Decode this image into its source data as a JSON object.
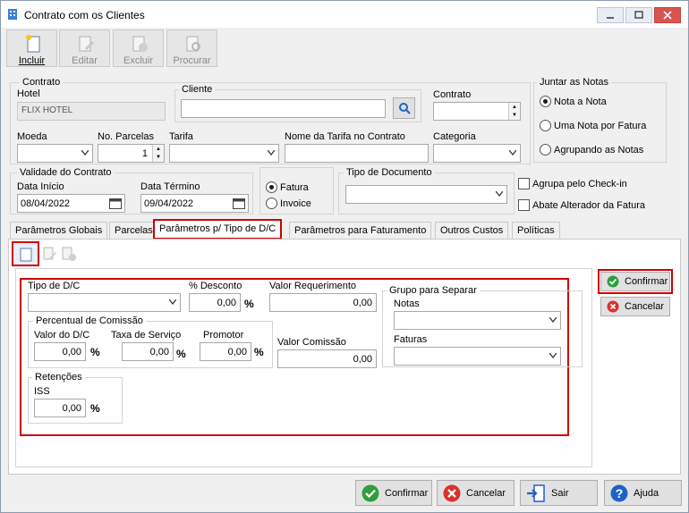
{
  "window": {
    "title": "Contrato com os Clientes"
  },
  "toolbar": {
    "incluir": "Incluir",
    "editar": "Editar",
    "excluir": "Excluir",
    "procurar": "Procurar"
  },
  "contrato_group": {
    "title": "Contrato",
    "hotel_label": "Hotel",
    "hotel_value": "FLIX HOTEL",
    "cliente_label": "Cliente",
    "cliente_value": "",
    "contrato_label": "Contrato",
    "contrato_value": ""
  },
  "row2": {
    "moeda_label": "Moeda",
    "parcelas_label": "No. Parcelas",
    "parcelas_value": "1",
    "tarifa_label": "Tarifa",
    "nome_tarifa_label": "Nome da Tarifa no Contrato",
    "categoria_label": "Categoria"
  },
  "juntar": {
    "title": "Juntar as Notas",
    "opt1": "Nota a Nota",
    "opt2": "Uma Nota por Fatura",
    "opt3": "Agrupando as Notas"
  },
  "validade": {
    "title": "Validade do Contrato",
    "inicio_label": "Data Início",
    "inicio_value": "08/04/2022",
    "termino_label": "Data Término",
    "termino_value": "09/04/2022"
  },
  "fatura_opts": {
    "fatura": "Fatura",
    "invoice": "Invoice"
  },
  "tipo_doc": {
    "label": "Tipo de Documento"
  },
  "checks": {
    "agrupa": "Agrupa pelo Check-in",
    "abate": "Abate Alterador da Fatura"
  },
  "tabs": [
    "Parâmetros Globais",
    "Parcelas",
    "Parâmetros p/ Tipo de D/C",
    "Parâmetros para Faturamento",
    "Outros Custos",
    "Políticas"
  ],
  "form": {
    "tipo_dc_label": "Tipo de D/C",
    "desconto_label": "% Desconto",
    "desconto_value": "0,00",
    "valor_req_label": "Valor Requerimento",
    "valor_req_value": "0,00",
    "grupo_title": "Grupo para Separar",
    "notas_label": "Notas",
    "faturas_label": "Faturas",
    "comissao_title": "Percentual de Comissão",
    "valor_dc_label": "Valor do D/C",
    "valor_dc_value": "0,00",
    "taxa_label": "Taxa de Serviço",
    "taxa_value": "0,00",
    "promotor_label": "Promotor",
    "promotor_value": "0,00",
    "valor_comissao_label": "Valor Comissão",
    "valor_comissao_value": "0,00",
    "retencoes_title": "Retenções",
    "iss_label": "ISS",
    "iss_value": "0,00",
    "pct": "%"
  },
  "side_buttons": {
    "confirmar": "Confirmar",
    "cancelar": "Cancelar"
  },
  "bottom_buttons": {
    "confirmar": "Confirmar",
    "cancelar": "Cancelar",
    "sair": "Sair",
    "ajuda": "Ajuda"
  },
  "colors": {
    "highlight": "#d00000",
    "confirm_green": "#2e9e3e",
    "cancel_red": "#d9322d",
    "help_blue": "#1e63c9"
  }
}
